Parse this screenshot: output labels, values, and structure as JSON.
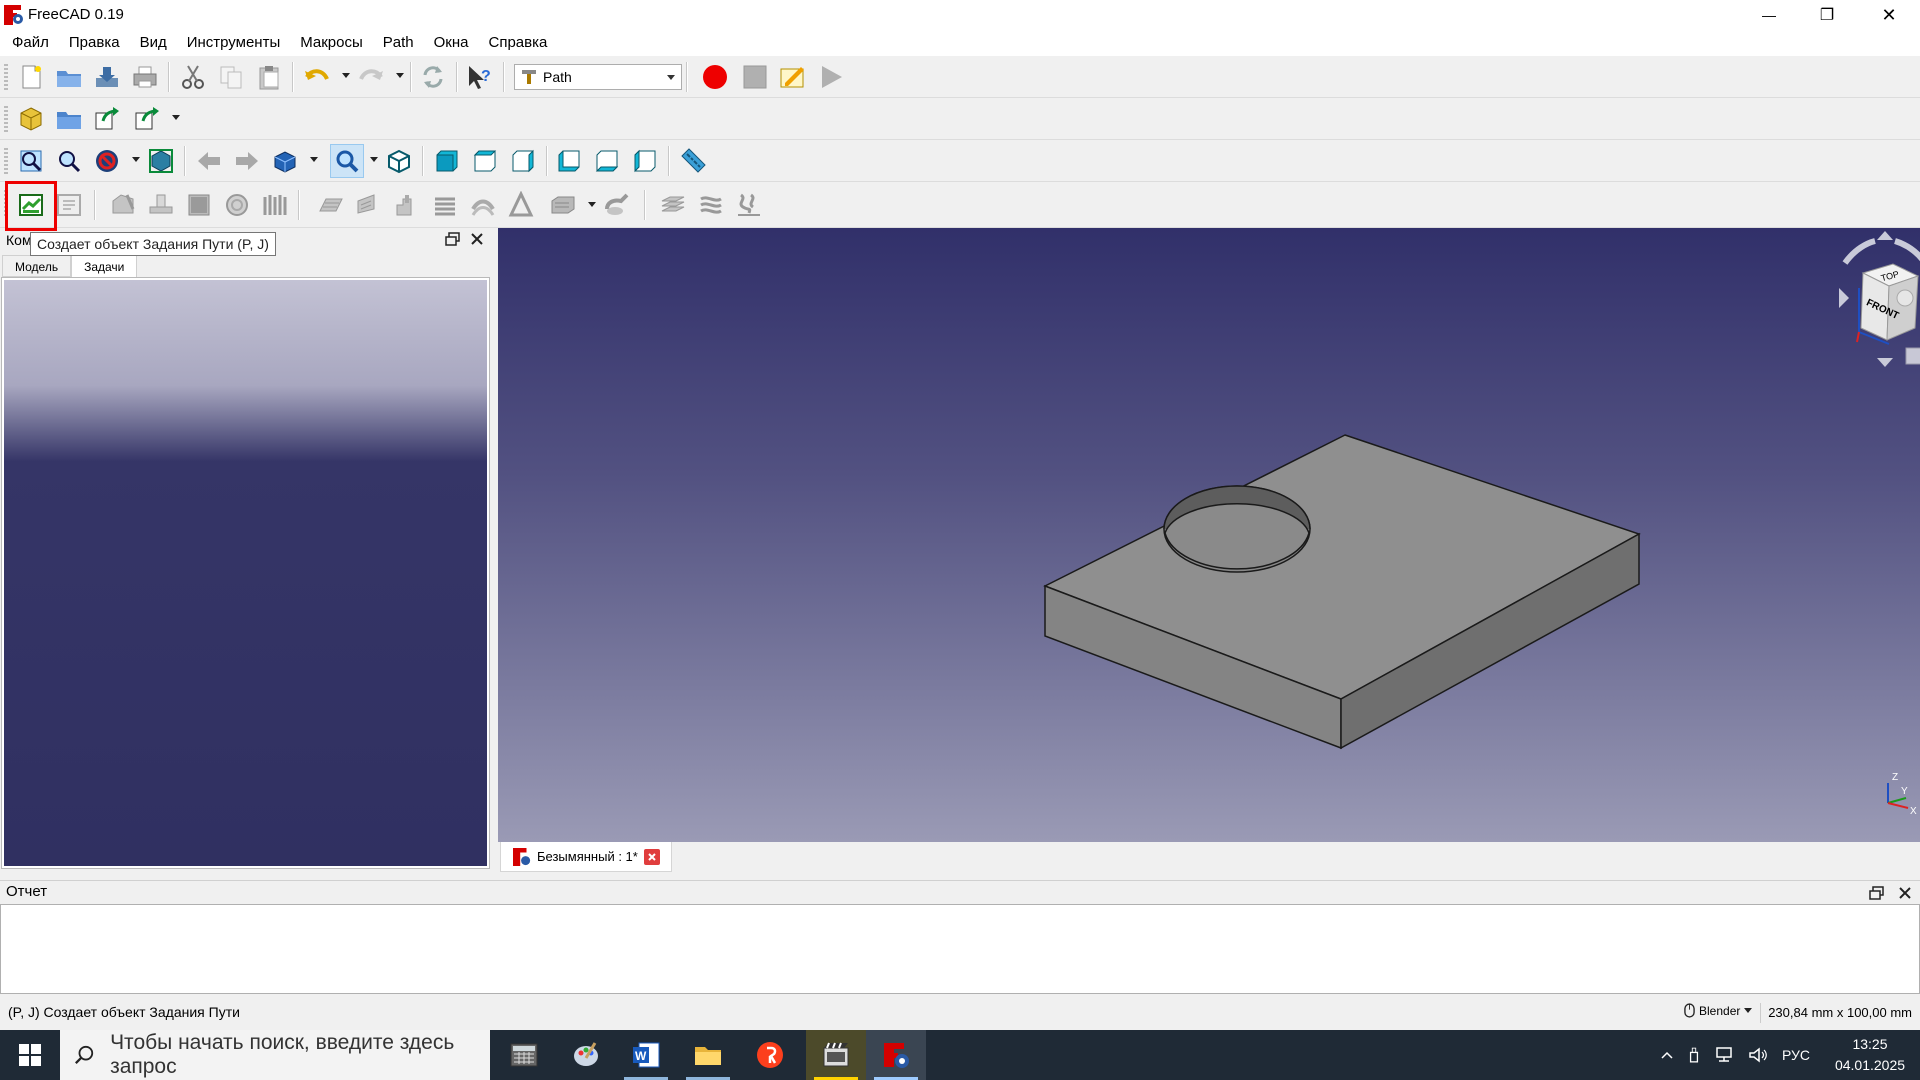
{
  "window": {
    "title": "FreeCAD 0.19",
    "min_glyph": "—",
    "max_glyph": "❐",
    "close_glyph": "✕"
  },
  "menu": [
    "Файл",
    "Правка",
    "Вид",
    "Инструменты",
    "Макросы",
    "Path",
    "Окна",
    "Справка"
  ],
  "toolbar": {
    "workbench": "Path",
    "file_icons": [
      "new-document-icon",
      "open-icon",
      "save-icon",
      "print-icon",
      "cut-icon",
      "copy-icon",
      "paste-icon",
      "undo-icon",
      "redo-icon",
      "refresh-icon",
      "whats-this-icon"
    ],
    "macro_icons": [
      "macro-record-icon",
      "macro-stop-icon",
      "macro-edit-icon",
      "macro-run-icon"
    ],
    "view_icons": [
      "fit-all-icon",
      "fit-selection-icon",
      "draw-style-icon",
      "bounding-box-icon",
      "back-icon",
      "forward-icon",
      "std-views-icon",
      "zoom-icon",
      "isometric-icon",
      "front-view-icon",
      "top-view-icon",
      "right-view-icon",
      "rear-view-icon",
      "bottom-view-icon",
      "left-view-icon",
      "measure-icon"
    ],
    "path_icons": [
      "job-icon",
      "post-process-icon",
      "profile-icon",
      "pocket-icon",
      "face-icon",
      "helix-icon",
      "array-icon",
      "adaptive-icon",
      "engrave-icon",
      "deburr-icon",
      "vcarve-icon",
      "drilling-icon",
      "waterline-icon",
      "surface-icon",
      "slot-icon",
      "simulator-icon",
      "probe-icon",
      "stack-icon",
      "inspect-icon"
    ]
  },
  "tooltip": "Создает объект Задания Пути (P, J)",
  "combo_view": {
    "title": "Комбо",
    "tabs": [
      "Модель",
      "Задачи"
    ],
    "active_tab": "Задачи"
  },
  "navcube": {
    "top": "TOP",
    "front": "FRONT"
  },
  "axis": {
    "x": "X",
    "y": "Y",
    "z": "Z"
  },
  "document_tab": "Безымянный : 1*",
  "report": {
    "title": "Отчет"
  },
  "status": {
    "text": "(P, J) Создает объект Задания Пути",
    "nav_style": "Blender",
    "dimensions": "230,84 mm x 100,00 mm"
  },
  "taskbar": {
    "search_placeholder": "Чтобы начать поиск, введите здесь запрос",
    "apps": [
      "calculator-app-icon",
      "paint-app-icon",
      "word-app-icon",
      "explorer-app-icon",
      "yandex-app-icon",
      "video-editor-app-icon",
      "freecad-app-icon"
    ],
    "lang": "РУС",
    "time": "13:25",
    "date": "04.01.2025"
  },
  "colors": {
    "accent_red": "#e00000",
    "view_top": "#31306a",
    "view_bottom": "#9a9ab5",
    "solid_face": "#8f8f8f"
  }
}
